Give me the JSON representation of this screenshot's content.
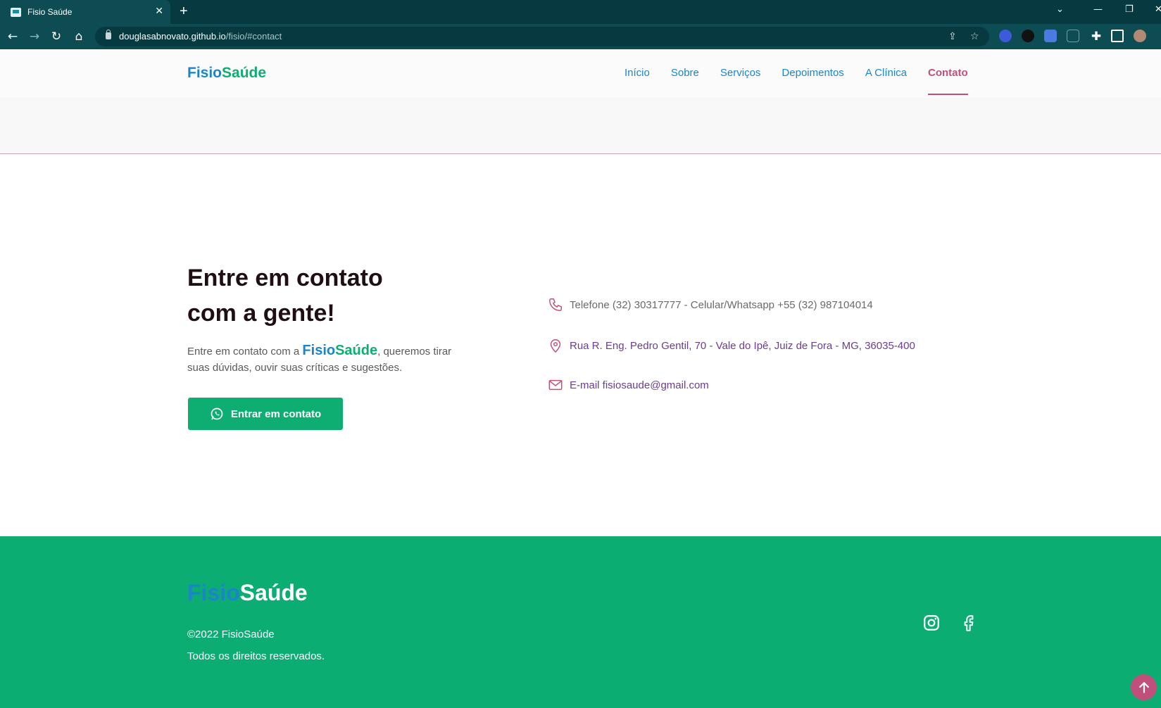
{
  "browser": {
    "tab_title": "Fisio Saúde",
    "tab_close": "✕",
    "new_tab": "+",
    "url_domain": "douglasabnovato.github.io",
    "url_path": "/fisio/#contact",
    "window_controls": [
      "⌄",
      "—",
      "❐",
      "✕"
    ]
  },
  "site": {
    "logo_part1": "Fisio",
    "logo_part2": "Saúde",
    "nav": [
      "Início",
      "Sobre",
      "Serviços",
      "Depoimentos",
      "A Clínica",
      "Contato"
    ],
    "active_nav": "Contato"
  },
  "contact": {
    "title_line1": "Entre em contato",
    "title_line2": "com a gente!",
    "text_before": "Entre em contato com a ",
    "text_after": ", queremos tirar suas dúvidas, ouvir suas críticas e sugestões.",
    "cta_label": "Entrar em contato",
    "phone": "Telefone (32) 30317777 - Celular/Whatsapp +55 (32) 987104014",
    "address": "Rua R. Eng. Pedro Gentil, 70 - Vale do Ipê, Juiz de Fora - MG, 36035-400",
    "email": "E-mail fisiosaude@gmail.com"
  },
  "footer": {
    "copyright": "©2022 FisioSaúde",
    "rights": "Todos os direitos reservados."
  },
  "colors": {
    "brand_blue": "#1a86c9",
    "brand_green": "#0eae73",
    "accent_pink": "#c0507b",
    "chrome_dark": "#063a40"
  },
  "icons": [
    "phone-icon",
    "location-icon",
    "mail-icon",
    "whatsapp-icon",
    "instagram-icon",
    "facebook-icon",
    "arrow-up-icon"
  ]
}
